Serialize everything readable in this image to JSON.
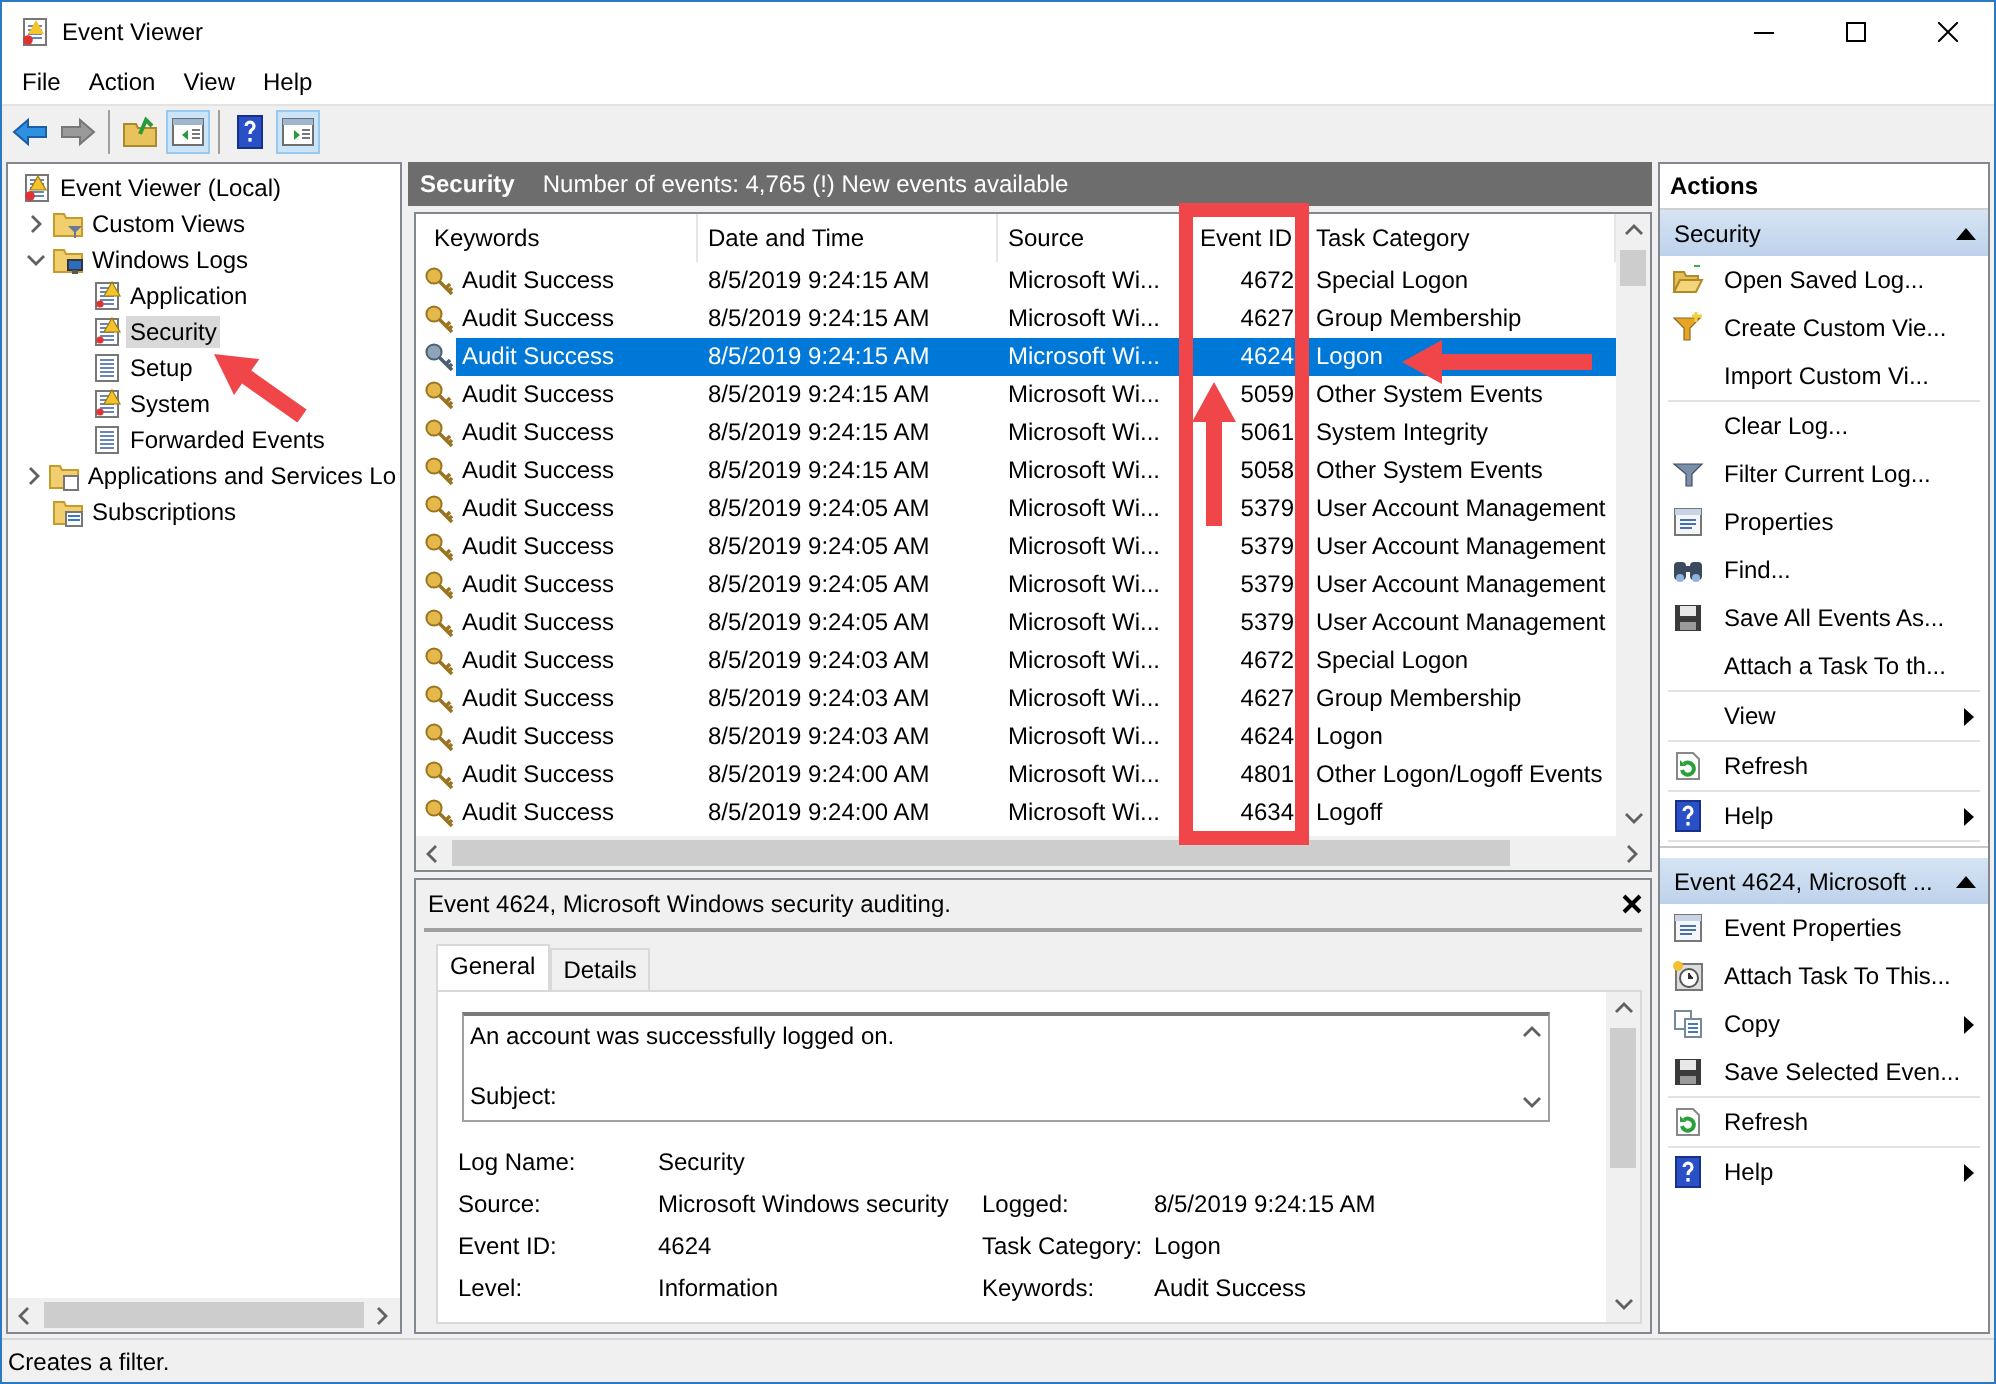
{
  "window": {
    "title": "Event Viewer"
  },
  "menu": [
    "File",
    "Action",
    "View",
    "Help"
  ],
  "toolbar": [
    [
      {
        "kind": "back",
        "pressed": false
      },
      {
        "kind": "forward",
        "pressed": false
      }
    ],
    [
      {
        "kind": "folder-up",
        "pressed": false
      },
      {
        "kind": "tree-pane",
        "pressed": true
      }
    ],
    [
      {
        "kind": "help",
        "pressed": false
      },
      {
        "kind": "action-pane",
        "pressed": true
      }
    ]
  ],
  "tree": {
    "label": "Event Viewer (Local)",
    "kind": "viewer",
    "selected": false,
    "children": [
      {
        "label": "Custom Views",
        "kind": "folder-filter",
        "selected": false,
        "expanded": false
      },
      {
        "label": "Windows Logs",
        "kind": "folder-monitor",
        "selected": false,
        "expanded": true,
        "children": [
          {
            "label": "Application",
            "kind": "log-warning",
            "selected": false
          },
          {
            "label": "Security",
            "kind": "log-warning",
            "selected": true
          },
          {
            "label": "Setup",
            "kind": "log",
            "selected": false
          },
          {
            "label": "System",
            "kind": "log-warning",
            "selected": false
          },
          {
            "label": "Forwarded Events",
            "kind": "log",
            "selected": false
          }
        ]
      },
      {
        "label": "Applications and Services Lo",
        "kind": "folder",
        "selected": false,
        "expanded": false
      },
      {
        "label": "Subscriptions",
        "kind": "subscriptions",
        "selected": false
      }
    ]
  },
  "log_header": {
    "title": "Security",
    "summary": "Number of events: 4,765 (!) New events available"
  },
  "table": {
    "columns": [
      "Keywords",
      "Date and Time",
      "Source",
      "Event ID",
      "Task Category"
    ],
    "rows": [
      {
        "keywords": "Audit Success",
        "date": "8/5/2019 9:24:15 AM",
        "source": "Microsoft Wi...",
        "event_id": "4672",
        "category": "Special Logon",
        "selected": false
      },
      {
        "keywords": "Audit Success",
        "date": "8/5/2019 9:24:15 AM",
        "source": "Microsoft Wi...",
        "event_id": "4627",
        "category": "Group Membership",
        "selected": false
      },
      {
        "keywords": "Audit Success",
        "date": "8/5/2019 9:24:15 AM",
        "source": "Microsoft Wi...",
        "event_id": "4624",
        "category": "Logon",
        "selected": true
      },
      {
        "keywords": "Audit Success",
        "date": "8/5/2019 9:24:15 AM",
        "source": "Microsoft Wi...",
        "event_id": "5059",
        "category": "Other System Events",
        "selected": false
      },
      {
        "keywords": "Audit Success",
        "date": "8/5/2019 9:24:15 AM",
        "source": "Microsoft Wi...",
        "event_id": "5061",
        "category": "System Integrity",
        "selected": false
      },
      {
        "keywords": "Audit Success",
        "date": "8/5/2019 9:24:15 AM",
        "source": "Microsoft Wi...",
        "event_id": "5058",
        "category": "Other System Events",
        "selected": false
      },
      {
        "keywords": "Audit Success",
        "date": "8/5/2019 9:24:05 AM",
        "source": "Microsoft Wi...",
        "event_id": "5379",
        "category": "User Account Management",
        "selected": false
      },
      {
        "keywords": "Audit Success",
        "date": "8/5/2019 9:24:05 AM",
        "source": "Microsoft Wi...",
        "event_id": "5379",
        "category": "User Account Management",
        "selected": false
      },
      {
        "keywords": "Audit Success",
        "date": "8/5/2019 9:24:05 AM",
        "source": "Microsoft Wi...",
        "event_id": "5379",
        "category": "User Account Management",
        "selected": false
      },
      {
        "keywords": "Audit Success",
        "date": "8/5/2019 9:24:05 AM",
        "source": "Microsoft Wi...",
        "event_id": "5379",
        "category": "User Account Management",
        "selected": false
      },
      {
        "keywords": "Audit Success",
        "date": "8/5/2019 9:24:03 AM",
        "source": "Microsoft Wi...",
        "event_id": "4672",
        "category": "Special Logon",
        "selected": false
      },
      {
        "keywords": "Audit Success",
        "date": "8/5/2019 9:24:03 AM",
        "source": "Microsoft Wi...",
        "event_id": "4627",
        "category": "Group Membership",
        "selected": false
      },
      {
        "keywords": "Audit Success",
        "date": "8/5/2019 9:24:03 AM",
        "source": "Microsoft Wi...",
        "event_id": "4624",
        "category": "Logon",
        "selected": false
      },
      {
        "keywords": "Audit Success",
        "date": "8/5/2019 9:24:00 AM",
        "source": "Microsoft Wi...",
        "event_id": "4801",
        "category": "Other Logon/Logoff Events",
        "selected": false
      },
      {
        "keywords": "Audit Success",
        "date": "8/5/2019 9:24:00 AM",
        "source": "Microsoft Wi...",
        "event_id": "4634",
        "category": "Logoff",
        "selected": false
      }
    ]
  },
  "detail": {
    "title": "Event 4624, Microsoft Windows security auditing.",
    "tabs": [
      {
        "label": "General",
        "selected": true
      },
      {
        "label": "Details",
        "selected": false
      }
    ],
    "description": [
      "An account was successfully logged on.",
      "Subject:"
    ],
    "fields": [
      [
        {
          "label": "Log Name:",
          "value": "Security"
        }
      ],
      [
        {
          "label": "Source:",
          "value": "Microsoft Windows security"
        },
        {
          "label": "Logged:",
          "value": "8/5/2019 9:24:15 AM"
        }
      ],
      [
        {
          "label": "Event ID:",
          "value": "4624"
        },
        {
          "label": "Task Category:",
          "value": "Logon"
        }
      ],
      [
        {
          "label": "Level:",
          "value": "Information"
        },
        {
          "label": "Keywords:",
          "value": "Audit Success"
        }
      ]
    ]
  },
  "actions": {
    "title": "Actions",
    "sections": [
      {
        "title": "Security",
        "expanded": true,
        "groups": [
          [
            {
              "label": "Open Saved Log...",
              "kind": "open-folder",
              "submenu": false
            },
            {
              "label": "Create Custom Vie...",
              "kind": "filter-new",
              "submenu": false
            },
            {
              "label": "Import Custom Vi...",
              "kind": "plain",
              "submenu": false
            }
          ],
          [
            {
              "label": "Clear Log...",
              "kind": "plain",
              "submenu": false
            },
            {
              "label": "Filter Current Log...",
              "kind": "filter",
              "submenu": false
            },
            {
              "label": "Properties",
              "kind": "properties",
              "submenu": false
            },
            {
              "label": "Find...",
              "kind": "binoculars",
              "submenu": false
            },
            {
              "label": "Save All Events As...",
              "kind": "floppy",
              "submenu": false
            },
            {
              "label": "Attach a Task To th...",
              "kind": "plain",
              "submenu": false
            }
          ],
          [
            {
              "label": "View",
              "kind": "plain",
              "submenu": true
            }
          ],
          [
            {
              "label": "Refresh",
              "kind": "refresh",
              "submenu": false
            }
          ],
          [
            {
              "label": "Help",
              "kind": "help",
              "submenu": true
            }
          ]
        ]
      },
      {
        "title": "Event 4624, Microsoft ...",
        "expanded": true,
        "groups": [
          [
            {
              "label": "Event Properties",
              "kind": "properties",
              "submenu": false
            },
            {
              "label": "Attach Task To This...",
              "kind": "clock",
              "submenu": false
            },
            {
              "label": "Copy",
              "kind": "copy",
              "submenu": true
            },
            {
              "label": "Save Selected Even...",
              "kind": "floppy",
              "submenu": false
            }
          ],
          [
            {
              "label": "Refresh",
              "kind": "refresh",
              "submenu": false
            }
          ],
          [
            {
              "label": "Help",
              "kind": "help",
              "submenu": true
            }
          ]
        ]
      }
    ]
  },
  "status_bar": "Creates a filter."
}
